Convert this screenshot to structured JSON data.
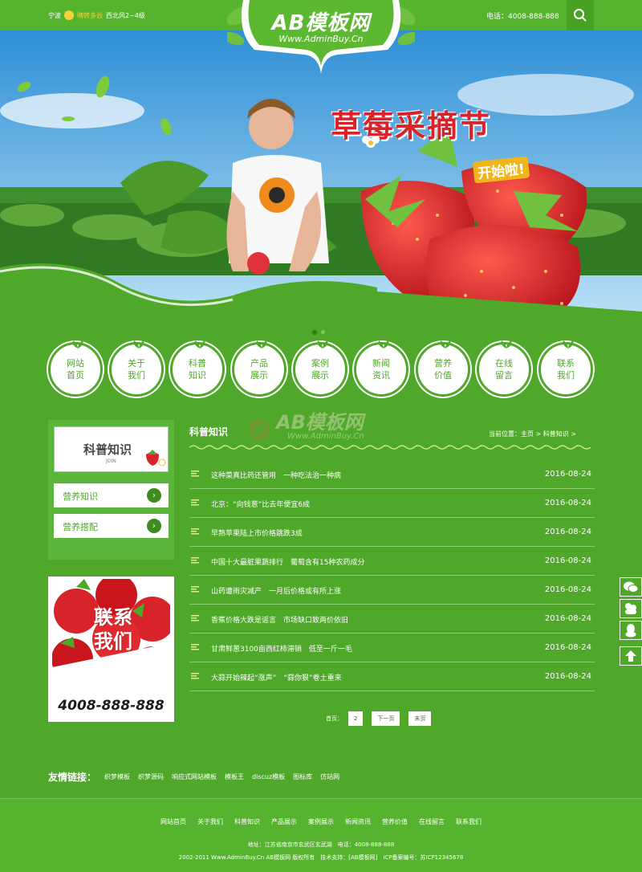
{
  "topbar": {
    "weather_city": "宁波",
    "weather_text": "晴转多云",
    "weather_wind": "西北风2~4级",
    "phone": "电话：4008-888-888"
  },
  "logo": {
    "title": "AB模板网",
    "subtitle": "Www.AdminBuy.Cn"
  },
  "banner": {
    "slogan": "草莓采摘节",
    "slogan2": "开始啦!"
  },
  "nav": {
    "items": [
      {
        "label": "网站首页"
      },
      {
        "label": "关于我们"
      },
      {
        "label": "科普知识"
      },
      {
        "label": "产品展示"
      },
      {
        "label": "案例展示"
      },
      {
        "label": "新闻资讯"
      },
      {
        "label": "营养价值"
      },
      {
        "label": "在线留言"
      },
      {
        "label": "联系我们"
      }
    ]
  },
  "sidebar": {
    "title": "科普知识",
    "join": "JOIN",
    "links": [
      {
        "label": "营养知识"
      },
      {
        "label": "营养搭配"
      }
    ],
    "contact_line1": "联系",
    "contact_line2": "我们",
    "contact_phone": "4008-888-888"
  },
  "main": {
    "title": "科普知识",
    "breadcrumb": "当前位置：主页 > 科普知识 >",
    "watermark_title": "AB模板网",
    "watermark_sub": "Www.AdminBuy.Cn",
    "articles": [
      {
        "title": "这种菜真比药还管用　一种吃法治一种病",
        "date": "2016-08-24"
      },
      {
        "title": "北京：“向钱葱”比去年便宜6成",
        "date": "2016-08-24"
      },
      {
        "title": "早熟苹果陆上市价格跳跌3成",
        "date": "2016-08-24"
      },
      {
        "title": "中国十大最脏果蔬排行　葡萄含有15种农药成分",
        "date": "2016-08-24"
      },
      {
        "title": "山药遭雨灾减产　一月后价格或有所上涨",
        "date": "2016-08-24"
      },
      {
        "title": "香蕉价格大跌是谣言　市场缺口致两价依旧",
        "date": "2016-08-24"
      },
      {
        "title": "甘肃鲜葱3100亩西红柿滞销　低至一斤一毛",
        "date": "2016-08-24"
      },
      {
        "title": "大蒜开始辣起“涨声”　“蒜你狠”卷土重来",
        "date": "2016-08-24"
      }
    ],
    "pager": {
      "label": "首页：",
      "page": "2",
      "next": "下一页",
      "last": "末页"
    }
  },
  "friends": {
    "label": "友情链接：",
    "links": [
      "织梦模板",
      "织梦源码",
      "响应式网站模板",
      "模板王",
      "discuz模板",
      "图标库",
      "仿站网"
    ]
  },
  "footer": {
    "nav": [
      "网站首页",
      "关于我们",
      "科普知识",
      "产品展示",
      "案例展示",
      "新闻资讯",
      "营养价值",
      "在线留言",
      "联系我们"
    ],
    "address": "地址：江苏省南京市玄武区玄武湖　电话：4008-888-888",
    "copyright": "2002-2011 Www.AdminBuy.Cn AB模板网 版权所有　技术支持：[AB模板网]　ICP备案编号：苏ICP12345678"
  },
  "colors": {
    "brand_green": "#4fa82a",
    "dark_green": "#3e8c1f",
    "strawberry_red": "#d8232a"
  },
  "icons": [
    "search-icon",
    "chevron-right-icon",
    "list-bullet-icon",
    "wechat-icon",
    "qq-icon",
    "qq-penguin-icon",
    "back-to-top-icon",
    "leaf-icon"
  ]
}
